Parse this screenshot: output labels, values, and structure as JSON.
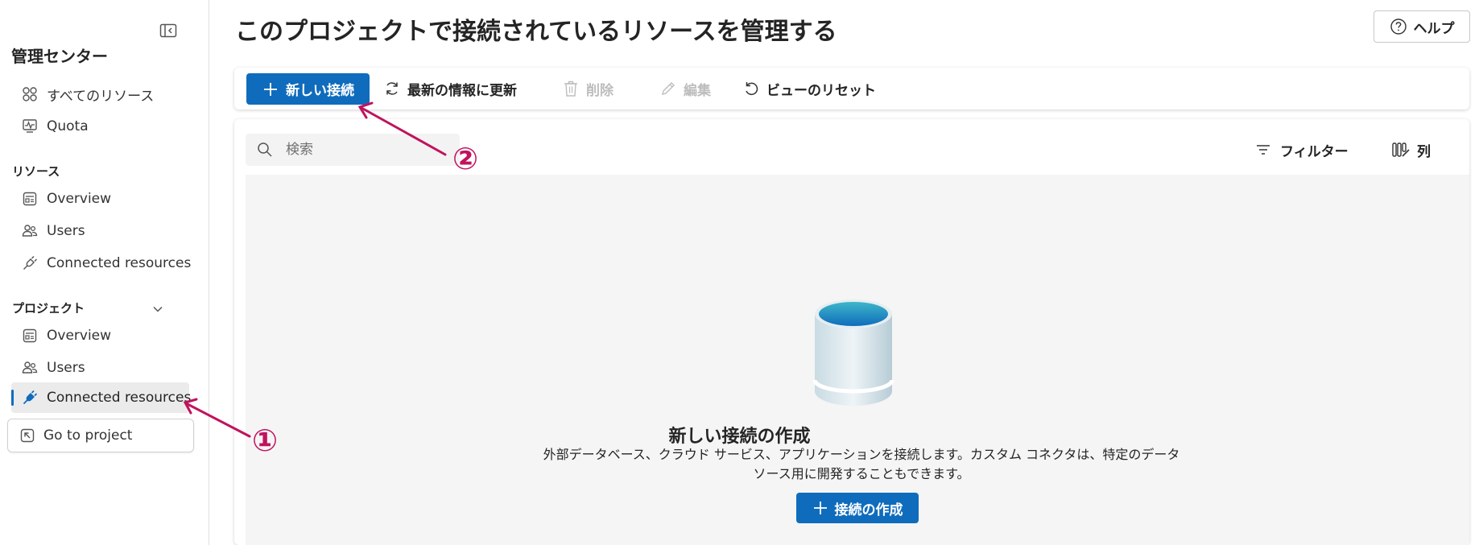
{
  "sidebar": {
    "title": "管理センター",
    "top_items": [
      {
        "label": "すべてのリソース",
        "icon": "grid-icon"
      },
      {
        "label": "Quota",
        "icon": "pulse-icon"
      }
    ],
    "resource_section": {
      "label": "リソース",
      "items": [
        {
          "label": "Overview",
          "icon": "overview-icon"
        },
        {
          "label": "Users",
          "icon": "users-icon"
        },
        {
          "label": "Connected resources",
          "icon": "plug-icon"
        }
      ]
    },
    "project_section": {
      "label": "プロジェクト",
      "items": [
        {
          "label": "Overview",
          "icon": "overview-icon"
        },
        {
          "label": "Users",
          "icon": "users-icon"
        },
        {
          "label": "Connected resources",
          "icon": "plug-icon",
          "selected": true
        }
      ]
    },
    "goto_project": "Go to project"
  },
  "header": {
    "title": "このプロジェクトで接続されているリソースを管理する",
    "help": "ヘルプ"
  },
  "toolbar": {
    "new_connection": "新しい接続",
    "refresh": "最新の情報に更新",
    "delete": "削除",
    "edit": "編集",
    "reset_view": "ビューのリセット"
  },
  "grid": {
    "search_placeholder": "検索",
    "filter": "フィルター",
    "columns": "列"
  },
  "empty_state": {
    "title": "新しい接続の作成",
    "description_line1": "外部データベース、クラウド サービス、アプリケーションを接続します。カスタム コネクタは、特定のデータ",
    "description_line2": "ソース用に開発することもできます。",
    "create_button": "接続の作成"
  },
  "annotations": {
    "marker1": "①",
    "marker2": "②"
  },
  "colors": {
    "accent": "#0f6cbd",
    "annotation": "#c0135e"
  }
}
